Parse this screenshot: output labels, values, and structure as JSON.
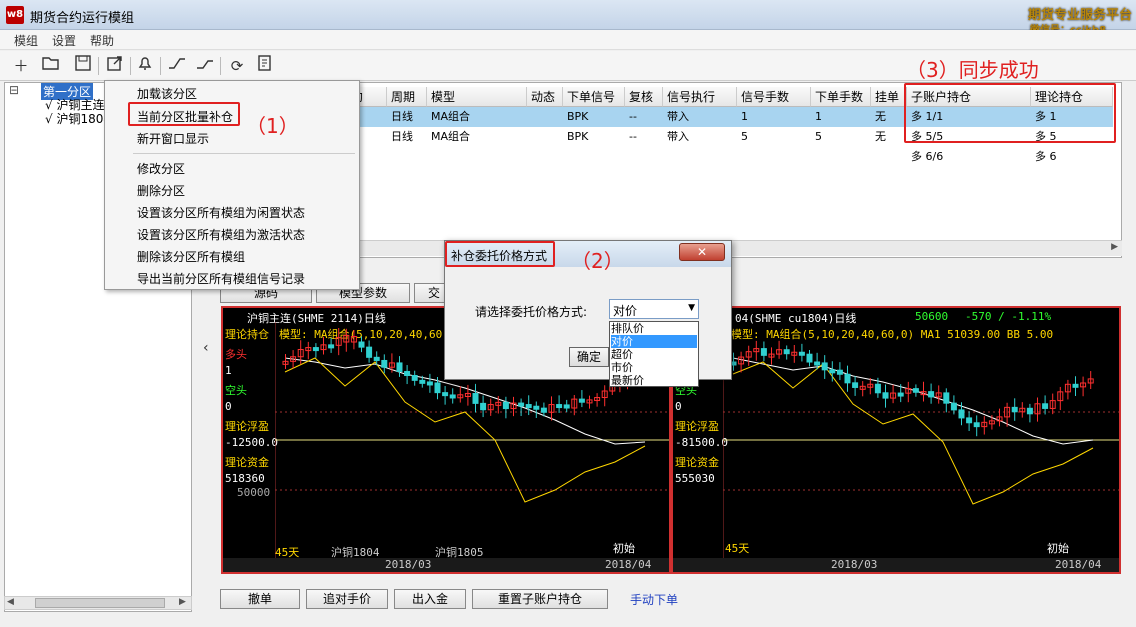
{
  "app": {
    "title": "期货合约运行模组",
    "brand_line1": "期货专业服务平台",
    "brand_line2": "微信号：ccikb8"
  },
  "menu": [
    "模组",
    "设置",
    "帮助"
  ],
  "toolbar_icons": [
    "new-icon",
    "open-icon",
    "save-icon",
    "export-icon",
    "bell-icon",
    "line-up-icon",
    "line-down-icon",
    "refresh-icon",
    "report-icon"
  ],
  "tree": {
    "root": "第一分区",
    "items": [
      "√ 沪铜主连",
      "√ 沪铜1804"
    ],
    "expander": "⊟"
  },
  "grid": {
    "headers": [
      "约",
      "周期",
      "模型",
      "动态",
      "下单信号",
      "复核",
      "信号执行",
      "信号手数",
      "下单手数",
      "挂单",
      "子账户持仓",
      "理论持仓"
    ],
    "rows": [
      [
        "",
        "日线",
        "MA组合",
        "",
        "BPK",
        "--",
        "带入",
        "1",
        "1",
        "无",
        "多 1/1",
        "多 1"
      ],
      [
        "",
        "日线",
        "MA组合",
        "",
        "BPK",
        "--",
        "带入",
        "5",
        "5",
        "无",
        "多 5/5",
        "多 5"
      ],
      [
        "",
        "",
        "",
        "",
        "",
        "",
        "",
        "",
        "",
        "",
        "多 6/6",
        "多 6"
      ]
    ]
  },
  "context_menu": {
    "group1": [
      "加载该分区",
      "当前分区批量补仓",
      "新开窗口显示"
    ],
    "group2": [
      "修改分区",
      "删除分区",
      "设置该分区所有模组为闲置状态",
      "设置该分区所有模组为激活状态",
      "删除该分区所有模组",
      "导出当前分区所有模组信号记录"
    ]
  },
  "annotations": {
    "a1": "（1）",
    "a2": "（2）",
    "a3": "（3）同步成功"
  },
  "tabs": [
    "源码",
    "模型参数",
    "交"
  ],
  "dialog": {
    "title": "补仓委托价格方式",
    "label": "请选择委托价格方式:",
    "selected": "对价",
    "options": [
      "排队价",
      "对价",
      "超价",
      "市价",
      "最新价"
    ],
    "ok": "确定"
  },
  "chart_left": {
    "header": "沪铜主连(SHME 2114)日线",
    "model": "模型: MA组合(5,10,20,40,60,0",
    "side_labels": [
      "理论持仓",
      "多头",
      "1",
      "空头",
      "0",
      "理论浮盈",
      "-12500.0",
      "理论资金",
      "518360"
    ],
    "y_label": "50000",
    "bottom": [
      "45天",
      "沪铜1804",
      "沪铜1805",
      "初始"
    ],
    "dates": [
      "2018/03",
      "2018/04"
    ]
  },
  "chart_right": {
    "header": "04(SHME cu1804)日线",
    "price": "50600",
    "change": "-570 / -1.11%",
    "model": "模型: MA组合(5,10,20,40,60,0)  MA1 51039.00  BB 5.00",
    "side_labels": [
      "理论持仓",
      "多头",
      "5",
      "空头",
      "0",
      "理论浮盈",
      "-81500.0",
      "理论资金",
      "555030"
    ],
    "bottom": [
      "45天",
      "初始"
    ],
    "dates": [
      "2018/03",
      "2018/04"
    ]
  },
  "bottom_buttons": [
    "撤单",
    "追对手价",
    "出入金",
    "重置子账户持仓"
  ],
  "manual_link": "手动下单"
}
